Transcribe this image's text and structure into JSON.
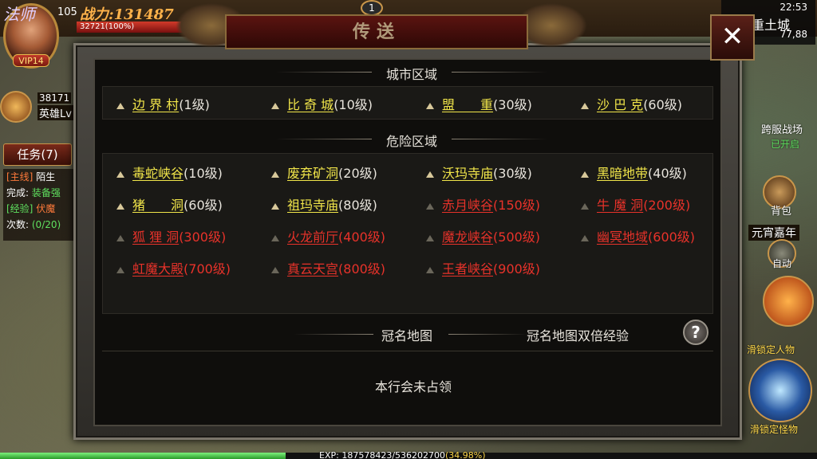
{
  "hud": {
    "avatar_name": "法师",
    "vip": "VIP14",
    "level": "105",
    "power_label": "战力:",
    "power_value": "131487",
    "hp": "32721(100%)",
    "hero_count": "38171",
    "hero_level": "英雄Lv",
    "quest_button": "任务(7)",
    "quests": [
      {
        "tag": "[主线]",
        "text": "陌生"
      },
      {
        "tag": "完成:",
        "text": "装备强"
      },
      {
        "tag": "[经验]",
        "text": "伏魔"
      },
      {
        "tag": "次数:",
        "text": "(0/20)"
      }
    ],
    "mail_badge": "1"
  },
  "status": {
    "time": "22:53",
    "map_name": "盟重土城",
    "coords": "77,88"
  },
  "right_panel": {
    "cross_server": "跨服战场",
    "cross_server_status": "已开启",
    "bag": "背包",
    "event": "元宵嘉年",
    "auto": "自动",
    "lock_player": "滑锁定人物",
    "lock_monster": "滑锁定怪物"
  },
  "exp": {
    "label": "EXP:",
    "current": "187578423/536202700",
    "percent": "(34.98%)",
    "fill_fraction": 0.3498
  },
  "dialog": {
    "title": "传送",
    "close": "✕",
    "city_section": "城市区域",
    "danger_section": "危险区域",
    "city": [
      {
        "name": "边 界 村",
        "level": "(1级)"
      },
      {
        "name": "比 奇 城",
        "level": "(10级)"
      },
      {
        "name": "盟　　重",
        "level": "(30级)"
      },
      {
        "name": "沙 巴 克",
        "level": "(60级)"
      }
    ],
    "danger": [
      {
        "name": "毒蛇峡谷",
        "level": "(10级)",
        "color": "yellow"
      },
      {
        "name": "废弃矿洞",
        "level": "(20级)",
        "color": "yellow"
      },
      {
        "name": "沃玛寺庙",
        "level": "(30级)",
        "color": "yellow"
      },
      {
        "name": "黑暗地带",
        "level": "(40级)",
        "color": "yellow"
      },
      {
        "name": "猪　　洞",
        "level": "(60级)",
        "color": "yellow"
      },
      {
        "name": "祖玛寺庙",
        "level": "(80级)",
        "color": "yellow"
      },
      {
        "name": "赤月峡谷",
        "level": "(150级)",
        "color": "red"
      },
      {
        "name": "牛 魔 洞",
        "level": "(200级)",
        "color": "red"
      },
      {
        "name": "狐 狸 洞",
        "level": "(300级)",
        "color": "red"
      },
      {
        "name": "火龙前厅",
        "level": "(400级)",
        "color": "red"
      },
      {
        "name": "魔龙峡谷",
        "level": "(500级)",
        "color": "red"
      },
      {
        "name": "幽冥地域",
        "level": "(600级)",
        "color": "red"
      },
      {
        "name": "虹魔大殿",
        "level": "(700级)",
        "color": "red"
      },
      {
        "name": "真云天宫",
        "level": "(800级)",
        "color": "red"
      },
      {
        "name": "王者峡谷",
        "level": "(900级)",
        "color": "red"
      }
    ],
    "crown_map": "冠名地图",
    "crown_double_exp": "冠名地图双倍经验",
    "help": "?",
    "guild_status": "本行会未占领"
  }
}
